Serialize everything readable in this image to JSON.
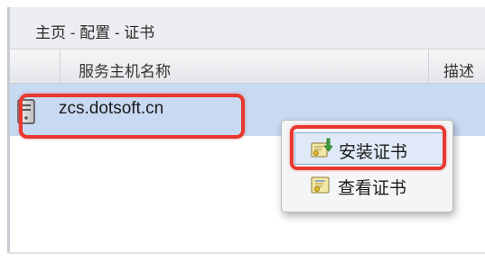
{
  "breadcrumb": "主页 - 配置 - 证书",
  "table": {
    "columns": [
      "服务主机名称",
      "描述"
    ],
    "rows": [
      {
        "name": "zcs.dotsoft.cn",
        "icon": "server-icon"
      }
    ]
  },
  "context_menu": {
    "items": [
      {
        "label": "安装证书",
        "icon": "install-certificate-icon"
      },
      {
        "label": "查看证书",
        "icon": "view-certificate-icon"
      }
    ]
  },
  "colors": {
    "highlight": "#e8382f",
    "row_selected": "#c8d9f2"
  }
}
